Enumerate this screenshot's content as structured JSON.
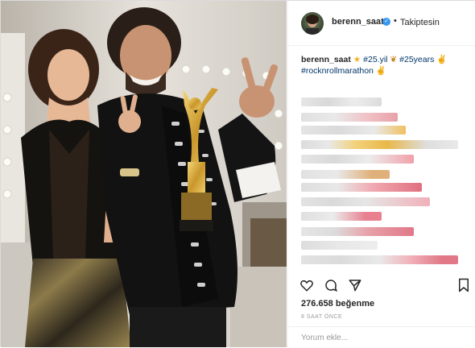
{
  "post": {
    "username": "berenn_saat",
    "follow_status": "Takiptesin",
    "separator": "•"
  },
  "caption": {
    "username": "berenn_saat",
    "hashtags": [
      "#25.yil",
      "#25years",
      "#rocknrollmarathon"
    ],
    "emojis": [
      "star",
      "butterfly",
      "rock-hand",
      "rock-hand"
    ]
  },
  "stats": {
    "likes": "276.658 beğenme",
    "time": "8 SAAT ÖNCE"
  },
  "comment": {
    "placeholder": "Yorum ekle..."
  },
  "colors": {
    "verified": "#3897f0",
    "hashtag": "#003569",
    "muted": "#999999",
    "border": "#efefef"
  }
}
